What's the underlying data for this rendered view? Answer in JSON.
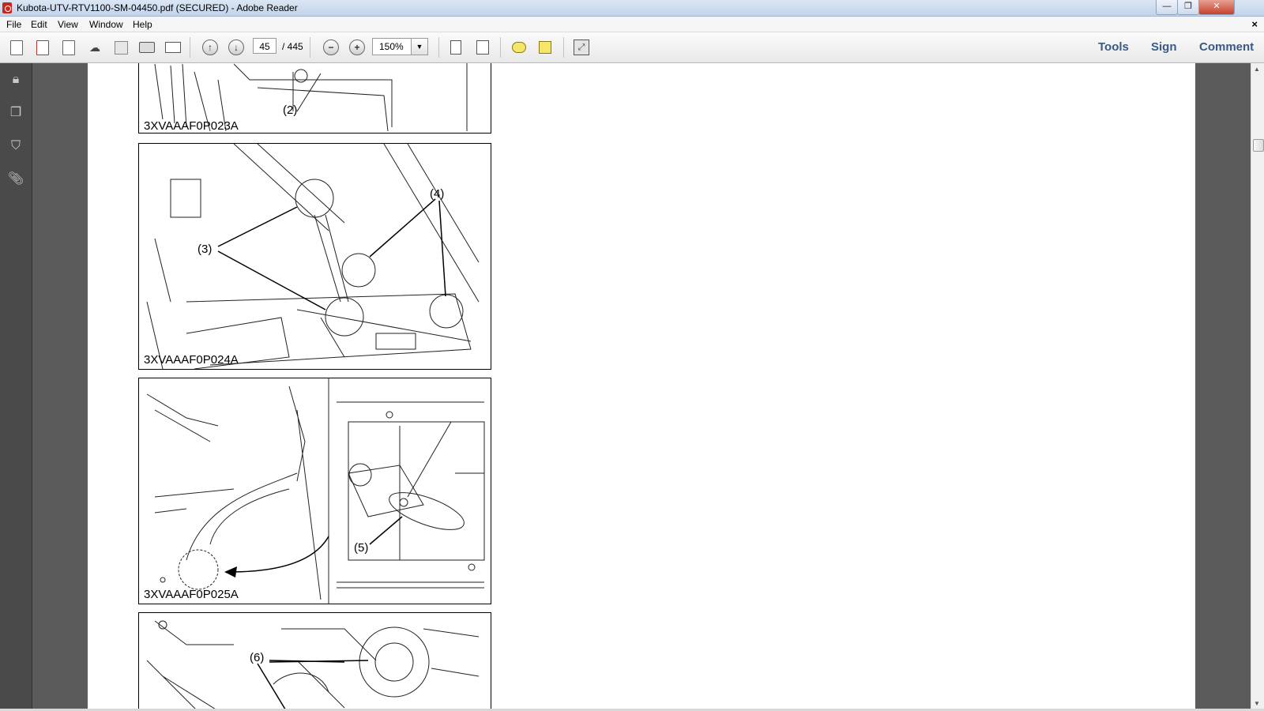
{
  "window": {
    "title": "Kubota-UTV-RTV1100-SM-04450.pdf (SECURED) - Adobe Reader",
    "controls": {
      "minimize": "—",
      "restore": "❐",
      "close": "✕"
    }
  },
  "menu": {
    "items": [
      "File",
      "Edit",
      "View",
      "Window",
      "Help"
    ],
    "close_symbol": "×"
  },
  "toolbar": {
    "page_current": "45",
    "page_total": "/ 445",
    "zoom": "150%",
    "links": {
      "tools": "Tools",
      "sign": "Sign",
      "comment": "Comment"
    }
  },
  "document": {
    "figures": [
      {
        "code": "3XVAAAF0P023A",
        "callouts": [
          "(2)"
        ]
      },
      {
        "code": "3XVAAAF0P024A",
        "callouts": [
          "(3)",
          "(4)"
        ]
      },
      {
        "code": "3XVAAAF0P025A",
        "callouts": [
          "(5)"
        ]
      },
      {
        "code": "",
        "callouts": [
          "(6)"
        ]
      }
    ]
  },
  "icons": {
    "nav": [
      "lock-icon",
      "pages-icon",
      "bookmark-icon",
      "attachment-icon"
    ]
  }
}
